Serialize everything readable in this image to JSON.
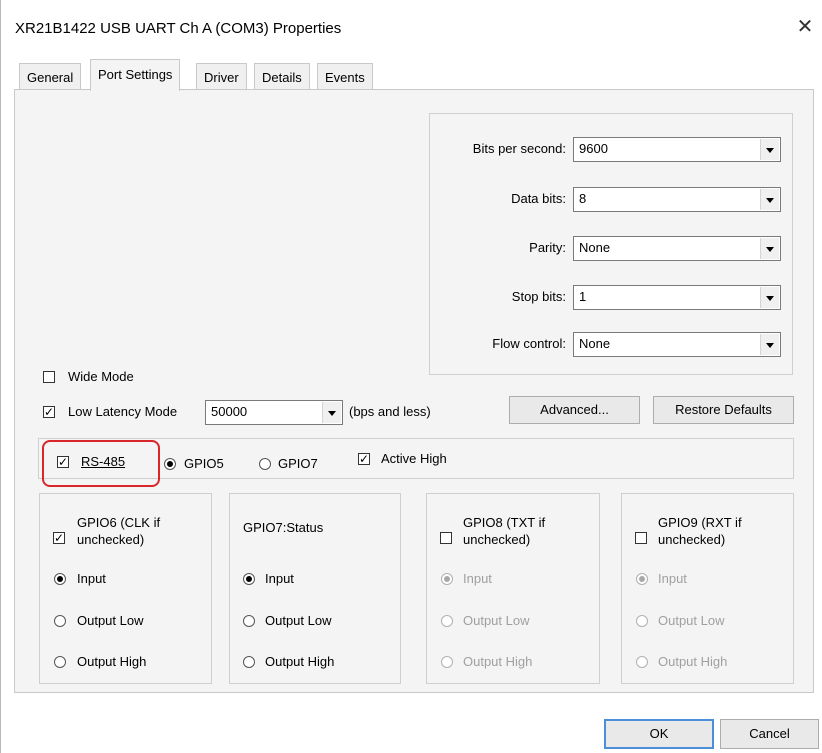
{
  "window": {
    "title": "XR21B1422 USB UART Ch A (COM3) Properties",
    "close_glyph": "✕"
  },
  "tabs": [
    "General",
    "Port Settings",
    "Driver",
    "Details",
    "Events"
  ],
  "port": {
    "bits_per_second": {
      "label": "Bits per second:",
      "value": "9600"
    },
    "data_bits": {
      "label": "Data bits:",
      "value": "8"
    },
    "parity": {
      "label": "Parity:",
      "value": "None"
    },
    "stop_bits": {
      "label": "Stop bits:",
      "value": "1"
    },
    "flow_control": {
      "label": "Flow control:",
      "value": "None"
    }
  },
  "wide_mode": {
    "label": "Wide Mode",
    "checked": false
  },
  "low_latency": {
    "label": "Low Latency Mode",
    "checked": true,
    "value": "50000",
    "suffix": "(bps and less)"
  },
  "buttons": {
    "advanced": "Advanced...",
    "restore": "Restore Defaults",
    "ok": "OK",
    "cancel": "Cancel"
  },
  "rs485": {
    "label": "RS-485",
    "checked": true,
    "gpio5": "GPIO5",
    "gpio5_selected": true,
    "gpio7": "GPIO7",
    "gpio7_selected": false,
    "active_high": "Active High",
    "active_high_checked": true
  },
  "gpio_groups": [
    {
      "title": "GPIO6 (CLK if unchecked)",
      "checked": true,
      "enabled": true
    },
    {
      "title": "GPIO7:Status",
      "enabled": true
    },
    {
      "title": "GPIO8 (TXT if unchecked)",
      "checked": false,
      "enabled": false
    },
    {
      "title": "GPIO9 (RXT if unchecked)",
      "checked": false,
      "enabled": false
    }
  ],
  "gpio_options": {
    "input": "Input",
    "output_low": "Output Low",
    "output_high": "Output High"
  },
  "colors": {
    "highlight": "#d8262a",
    "panel": "#f4f4f4"
  }
}
